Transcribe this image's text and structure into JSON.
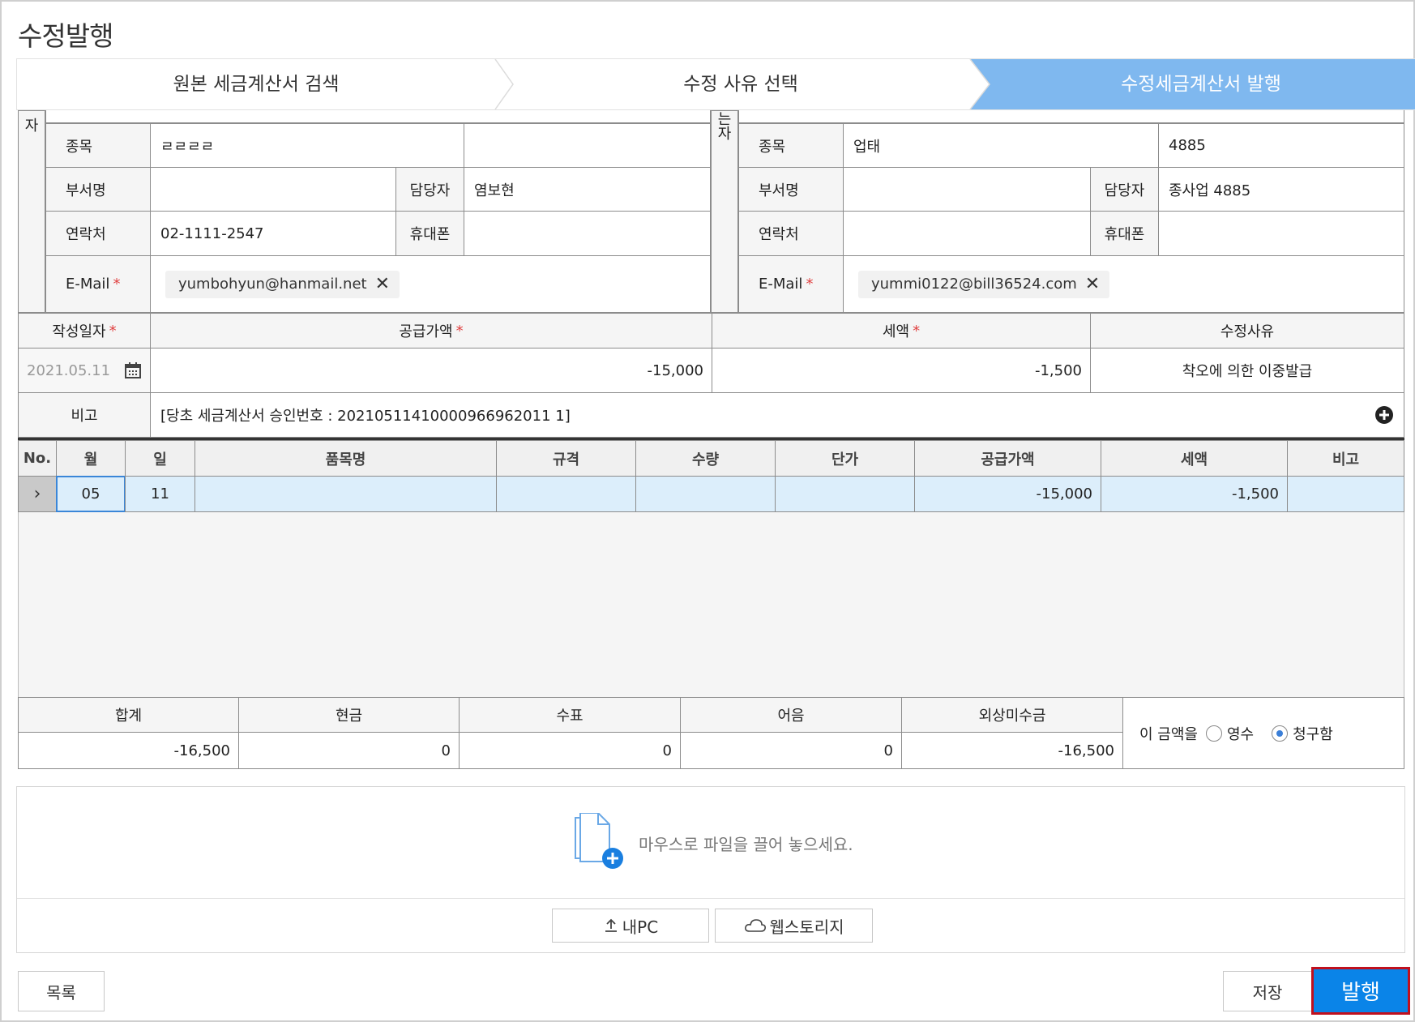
{
  "page": {
    "title": "수정발행"
  },
  "steps": [
    {
      "label": "원본 세금계산서 검색"
    },
    {
      "label": "수정 사유 선택"
    },
    {
      "label": "수정세금계산서 발행"
    }
  ],
  "supplier": {
    "side_label": "자",
    "rows": {
      "item_label": "종목",
      "item_value": "ㄹㄹㄹㄹ",
      "dept_label": "부서명",
      "dept_value": "",
      "manager_label": "담당자",
      "manager_value": "염보현",
      "phone_label": "연락처",
      "phone_value": "02-1111-2547",
      "mobile_label": "휴대폰",
      "mobile_value": "",
      "email_label": "E-Mail",
      "email_value": "yumbohyun@hanmail.net"
    }
  },
  "receiver": {
    "side_label": "는\n자",
    "rows": {
      "item_label": "종목",
      "business_value": "업태",
      "item_value": "4885",
      "dept_label": "부서명",
      "dept_value": "",
      "manager_label": "담당자",
      "manager_value": "종사업 4885",
      "phone_label": "연락처",
      "phone_value": "",
      "mobile_label": "휴대폰",
      "mobile_value": "",
      "email_label": "E-Mail",
      "email_value": "yummi0122@bill36524.com"
    }
  },
  "summary": {
    "date_label": "작성일자",
    "supply_label": "공급가액",
    "tax_label": "세액",
    "reason_label": "수정사유",
    "date_value": "2021.05.11",
    "supply_value": "-15,000",
    "tax_value": "-1,500",
    "reason_value": "착오에 의한 이중발급",
    "remark_label": "비고",
    "remark_value": "[당초 세금계산서 승인번호 : 20210511410000966962011 1]"
  },
  "items_table": {
    "headers": [
      "No.",
      "월",
      "일",
      "품목명",
      "규격",
      "수량",
      "단가",
      "공급가액",
      "세액",
      "비고"
    ],
    "rows": [
      {
        "month": "05",
        "day": "11",
        "name": "",
        "spec": "",
        "qty": "",
        "price": "",
        "supply": "-15,000",
        "tax": "-1,500",
        "remark": ""
      }
    ]
  },
  "totals": {
    "headers": [
      "합계",
      "현금",
      "수표",
      "어음",
      "외상미수금"
    ],
    "values": [
      "-16,500",
      "0",
      "0",
      "0",
      "-16,500"
    ],
    "amount_prefix": "이 금액을",
    "option_receipt": "영수",
    "option_claim": "청구함",
    "selected": "청구함"
  },
  "attach": {
    "hint": "마우스로 파일을 끌어 놓으세요.",
    "my_pc": "내PC",
    "webstorage": "웹스토리지"
  },
  "footer": {
    "list": "목록",
    "save": "저장",
    "issue": "발행"
  },
  "colors": {
    "accent": "#0a84e8",
    "step_active": "#7fb8ef",
    "selected_row": "#dceefb",
    "issue_border": "#c0101e"
  }
}
